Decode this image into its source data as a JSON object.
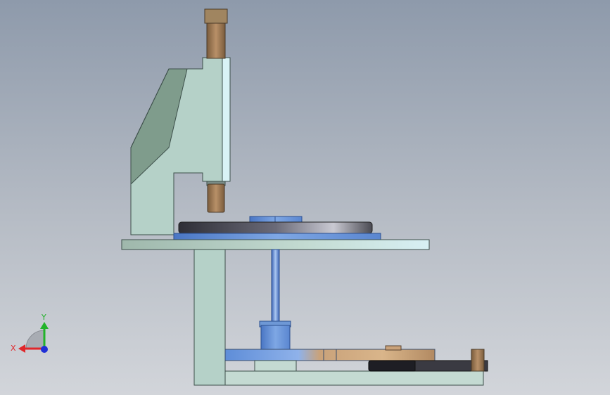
{
  "viewport": {
    "model": "press-assembly-side-view"
  },
  "triad": {
    "x_label": "X",
    "y_label": "Y",
    "x_color": "#e0262a",
    "y_color": "#22b32a",
    "z_color": "#1f2fd6"
  },
  "colors": {
    "frame": "#b5d1c8",
    "frame_edge": "#3d4f4a",
    "frame_shadow": "#7f9c8c",
    "bronze": "#a07a52",
    "blue_part": "#6e98d6",
    "dark_disk": "#3e3e48",
    "background_top": "#8e9aab",
    "background_bottom": "#d2d5da"
  }
}
